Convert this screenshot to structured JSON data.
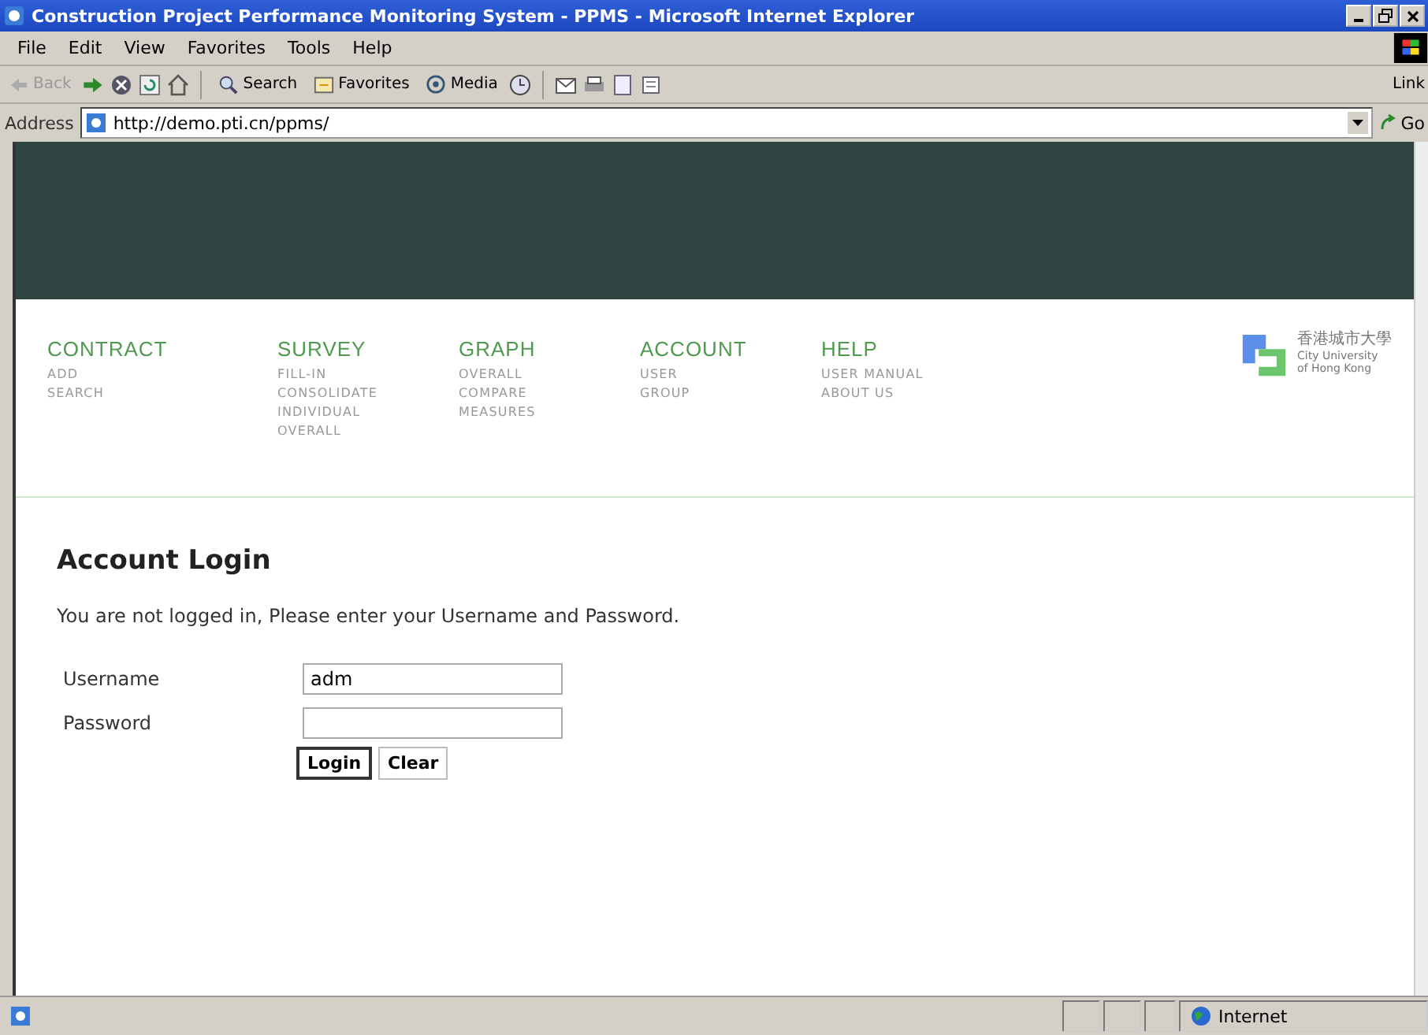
{
  "window": {
    "title": "Construction Project Performance Monitoring System - PPMS - Microsoft Internet Explorer"
  },
  "menu": [
    "File",
    "Edit",
    "View",
    "Favorites",
    "Tools",
    "Help"
  ],
  "toolbar": {
    "back": {
      "label": "Back",
      "disabled": true
    },
    "search": "Search",
    "favorites": "Favorites",
    "media": "Media",
    "links": "Link"
  },
  "address": {
    "label": "Address",
    "value": "http://demo.pti.cn/ppms/",
    "go": "Go"
  },
  "nav": [
    {
      "title": "CONTRACT",
      "items": [
        "ADD",
        "SEARCH"
      ]
    },
    {
      "title": "SURVEY",
      "items": [
        "FILL-IN",
        "CONSOLIDATE",
        "INDIVIDUAL",
        "OVERALL"
      ]
    },
    {
      "title": "GRAPH",
      "items": [
        "OVERALL",
        "COMPARE",
        "MEASURES"
      ]
    },
    {
      "title": "ACCOUNT",
      "items": [
        "USER",
        "GROUP"
      ]
    },
    {
      "title": "HELP",
      "items": [
        "USER MANUAL",
        "ABOUT US"
      ]
    }
  ],
  "logo": {
    "chinese": "香港城市大學",
    "lines": [
      "City University",
      "of Hong Kong"
    ]
  },
  "login": {
    "heading": "Account Login",
    "message": "You are not logged in, Please enter your Username and Password.",
    "fields": [
      {
        "label": "Username",
        "value": "adm"
      },
      {
        "label": "Password"
      }
    ],
    "buttons": [
      {
        "label": "Login",
        "default": true
      },
      {
        "label": "Clear",
        "default": false
      }
    ]
  },
  "status_bar": {
    "zone": "Internet"
  }
}
